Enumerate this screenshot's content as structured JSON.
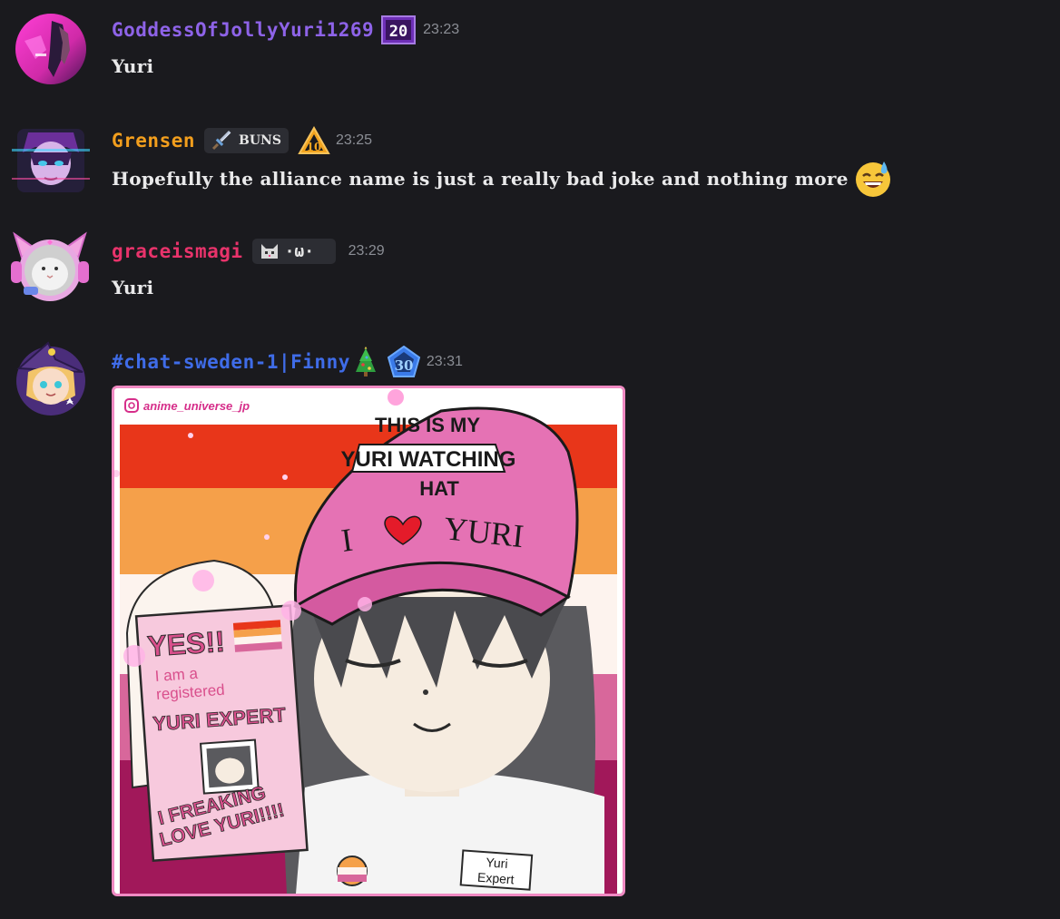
{
  "messages": [
    {
      "username": "GoddessOfJollyYuri1269",
      "username_color": "#8e63e8",
      "badge_level": "20",
      "time": "23:23",
      "text": "Yuri"
    },
    {
      "username": "Grensen",
      "username_color": "#f29e1d",
      "tag_text": "BUNS",
      "badge_level": "10",
      "time": "23:25",
      "text": "Hopefully the alliance name is just a really bad joke and nothing more"
    },
    {
      "username": "graceismagi",
      "username_color": "#e8336b",
      "tag_text": "·ω·",
      "time": "23:29",
      "text": "Yuri"
    },
    {
      "username": "#chat-sweden-1|Finny",
      "username_color": "#3f6ce8",
      "badge_level": "30",
      "time": "23:31",
      "attachment": {
        "watermark": "anime_universe_jp",
        "cap_line1": "THIS IS MY",
        "cap_line2": "YURI WATCHING",
        "cap_line3": "HAT",
        "cap_brim": "I",
        "cap_brim2": "YURI",
        "card_yes": "YES!!",
        "card_line1": "I am a",
        "card_line2": "registered",
        "card_title": "YURI EXPERT",
        "card_bottom1": "I FREAKING",
        "card_bottom2": "LOVE YURI!!!!",
        "tag_line1": "Yuri",
        "tag_line2": "Expert"
      }
    }
  ]
}
